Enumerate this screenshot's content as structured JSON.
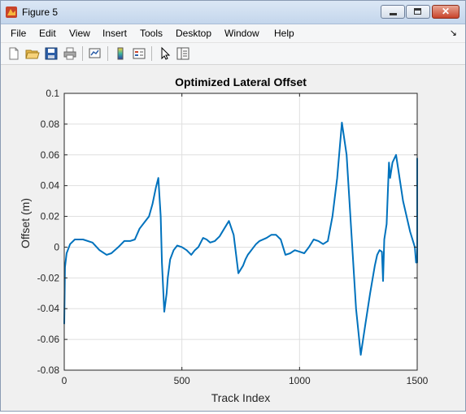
{
  "window": {
    "title": "Figure 5",
    "minimize_icon": "minimize-icon",
    "maximize_icon": "maximize-icon",
    "close_icon": "close-icon"
  },
  "menu": [
    "File",
    "Edit",
    "View",
    "Insert",
    "Tools",
    "Desktop",
    "Window",
    "Help"
  ],
  "toolbar_icons": [
    "new-figure-icon",
    "open-file-icon",
    "save-icon",
    "print-icon",
    "link-plot-icon",
    "insert-colorbar-icon",
    "insert-legend-icon",
    "edit-plot-icon",
    "property-inspector-icon"
  ],
  "colors": {
    "line": "#0072bd",
    "grid": "#dfdfdf",
    "axes_bg": "#ffffff",
    "figure_bg": "#f0f0f0"
  },
  "chart_data": {
    "type": "line",
    "title": "Optimized Lateral Offset",
    "xlabel": "Track Index",
    "ylabel": "Offset (m)",
    "xlim": [
      0,
      1500
    ],
    "ylim": [
      -0.08,
      0.1
    ],
    "xticks": [
      0,
      500,
      1000,
      1500
    ],
    "yticks": [
      -0.08,
      -0.06,
      -0.04,
      -0.02,
      0,
      0.02,
      0.04,
      0.06,
      0.08,
      0.1
    ],
    "xtick_labels": [
      "0",
      "500",
      "1000",
      "1500"
    ],
    "ytick_labels": [
      "-0.08",
      "-0.06",
      "-0.04",
      "-0.02",
      "0",
      "0.02",
      "0.04",
      "0.06",
      "0.08",
      "0.1"
    ],
    "grid": true,
    "series": [
      {
        "x": [
          0,
          3,
          10,
          25,
          45,
          60,
          80,
          120,
          150,
          180,
          200,
          230,
          255,
          280,
          300,
          320,
          340,
          360,
          375,
          390,
          400,
          410,
          415,
          425,
          435,
          440,
          450,
          465,
          480,
          500,
          520,
          540,
          555,
          570,
          590,
          605,
          620,
          640,
          660,
          680,
          700,
          720,
          740,
          760,
          770,
          780,
          790,
          800,
          815,
          830,
          860,
          880,
          900,
          920,
          940,
          960,
          980,
          1000,
          1020,
          1040,
          1060,
          1080,
          1100,
          1120,
          1140,
          1160,
          1180,
          1200,
          1220,
          1240,
          1260,
          1280,
          1300,
          1320,
          1330,
          1340,
          1350,
          1355,
          1360,
          1370,
          1380,
          1385,
          1395,
          1410,
          1440,
          1470,
          1490,
          1495,
          1500,
          1500
        ],
        "y": [
          -0.05,
          -0.013,
          -0.004,
          0.002,
          0.005,
          0.005,
          0.005,
          0.003,
          -0.002,
          -0.005,
          -0.004,
          0.0,
          0.004,
          0.004,
          0.005,
          0.012,
          0.016,
          0.02,
          0.028,
          0.039,
          0.045,
          0.02,
          -0.01,
          -0.042,
          -0.03,
          -0.02,
          -0.008,
          -0.002,
          0.001,
          0.0,
          -0.002,
          -0.005,
          -0.002,
          0.0,
          0.006,
          0.005,
          0.003,
          0.004,
          0.007,
          0.012,
          0.017,
          0.008,
          -0.017,
          -0.012,
          -0.008,
          -0.005,
          -0.003,
          -0.001,
          0.002,
          0.004,
          0.006,
          0.008,
          0.008,
          0.005,
          -0.005,
          -0.004,
          -0.002,
          -0.003,
          -0.004,
          0.0,
          0.005,
          0.004,
          0.002,
          0.004,
          0.02,
          0.045,
          0.081,
          0.06,
          0.01,
          -0.04,
          -0.07,
          -0.05,
          -0.03,
          -0.012,
          -0.005,
          -0.002,
          -0.003,
          -0.022,
          0.005,
          0.015,
          0.055,
          0.045,
          0.055,
          0.06,
          0.03,
          0.01,
          0.0,
          -0.01,
          -0.01,
          0.058
        ]
      }
    ]
  }
}
